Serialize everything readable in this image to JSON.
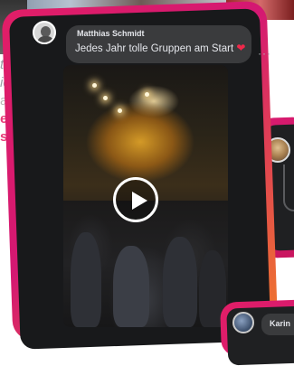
{
  "main_post": {
    "author": "Matthias Schmidt",
    "comment": "Jedes Jahr tolle Gruppen am Start",
    "heart_emoji": "❤",
    "more_label": "···"
  },
  "bottom_post": {
    "author": "Karin"
  },
  "background_text": {
    "line1": "ter",
    "line2": "ich",
    "line3": "a",
    "line4": "e",
    "line5": "s"
  },
  "colors": {
    "card_gradient_start": "#e11e67",
    "card_gradient_end": "#f07a2a",
    "card_background": "#18191b",
    "bubble_background": "#3a3b3d",
    "text_primary": "#e4e6eb",
    "heart": "#f0284a"
  },
  "icons": {
    "play": "play-icon",
    "more": "more-icon",
    "heart": "heart-icon"
  }
}
